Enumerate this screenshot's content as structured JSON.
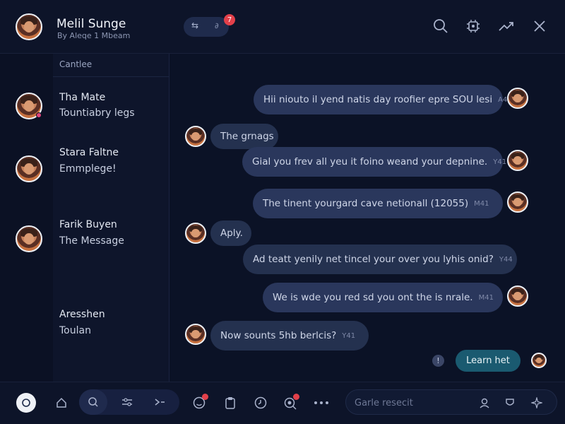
{
  "header": {
    "title": "Melil Sunge",
    "subtitle": "By Aleqe 1 Mbeam",
    "badge_glyph": "⇆",
    "badge_count": "∂",
    "notification_count": "7",
    "icons": [
      "search-icon",
      "settings-icon",
      "trend-icon",
      "close-icon"
    ]
  },
  "sidebar": {
    "section_label": "Cantlee",
    "contacts": [
      {
        "name": "Tha Mate",
        "subtitle": "Tountiabry legs"
      },
      {
        "name": "Stara Faltne",
        "subtitle": "Emmplege!"
      },
      {
        "name": "Farik Buyen",
        "subtitle": "The Message"
      },
      {
        "name": "Aresshen",
        "subtitle": "Toulan"
      }
    ]
  },
  "messages": [
    {
      "direction": "out",
      "text": "Hii niouto il yend natis day roofier epre SOU lesi",
      "time": "A41"
    },
    {
      "direction": "in",
      "text": "The grnags",
      "time": ""
    },
    {
      "direction": "out",
      "text": "Gial you frev all yeu it foino weand your depnine.",
      "time": "Y41"
    },
    {
      "direction": "out",
      "text": "The tinent yourgard cave netionall (12055)",
      "time": "M41"
    },
    {
      "direction": "in",
      "text": "Aply.",
      "time": ""
    },
    {
      "direction": "in",
      "text": "Ad teatt yenily net tincel your over you lyhis onid?",
      "time": "Y44"
    },
    {
      "direction": "out",
      "text": "We is wde you red sd you ont the is nrale.",
      "time": "M41"
    },
    {
      "direction": "in",
      "text": "Now sounts 5hb berlcis?",
      "time": "Y41"
    }
  ],
  "action": {
    "info_glyph": "!",
    "button_label": "Learn het"
  },
  "bottombar": {
    "icons": [
      "status-icon",
      "home-icon",
      "search-icon",
      "filter-icon",
      "forward-icon",
      "emoji-icon",
      "clipboard-icon",
      "timer-icon",
      "scan-icon",
      "more-icon"
    ],
    "search_placeholder": "Garle resecit",
    "search_icons": [
      "user-icon",
      "bookmark-icon",
      "sparkle-icon"
    ]
  },
  "colors": {
    "background": "#0b1226",
    "bubble_out": "#2a375c",
    "bubble_in": "#24314f",
    "accent_button": "#1a5a70",
    "badge_red": "#e2404a"
  }
}
